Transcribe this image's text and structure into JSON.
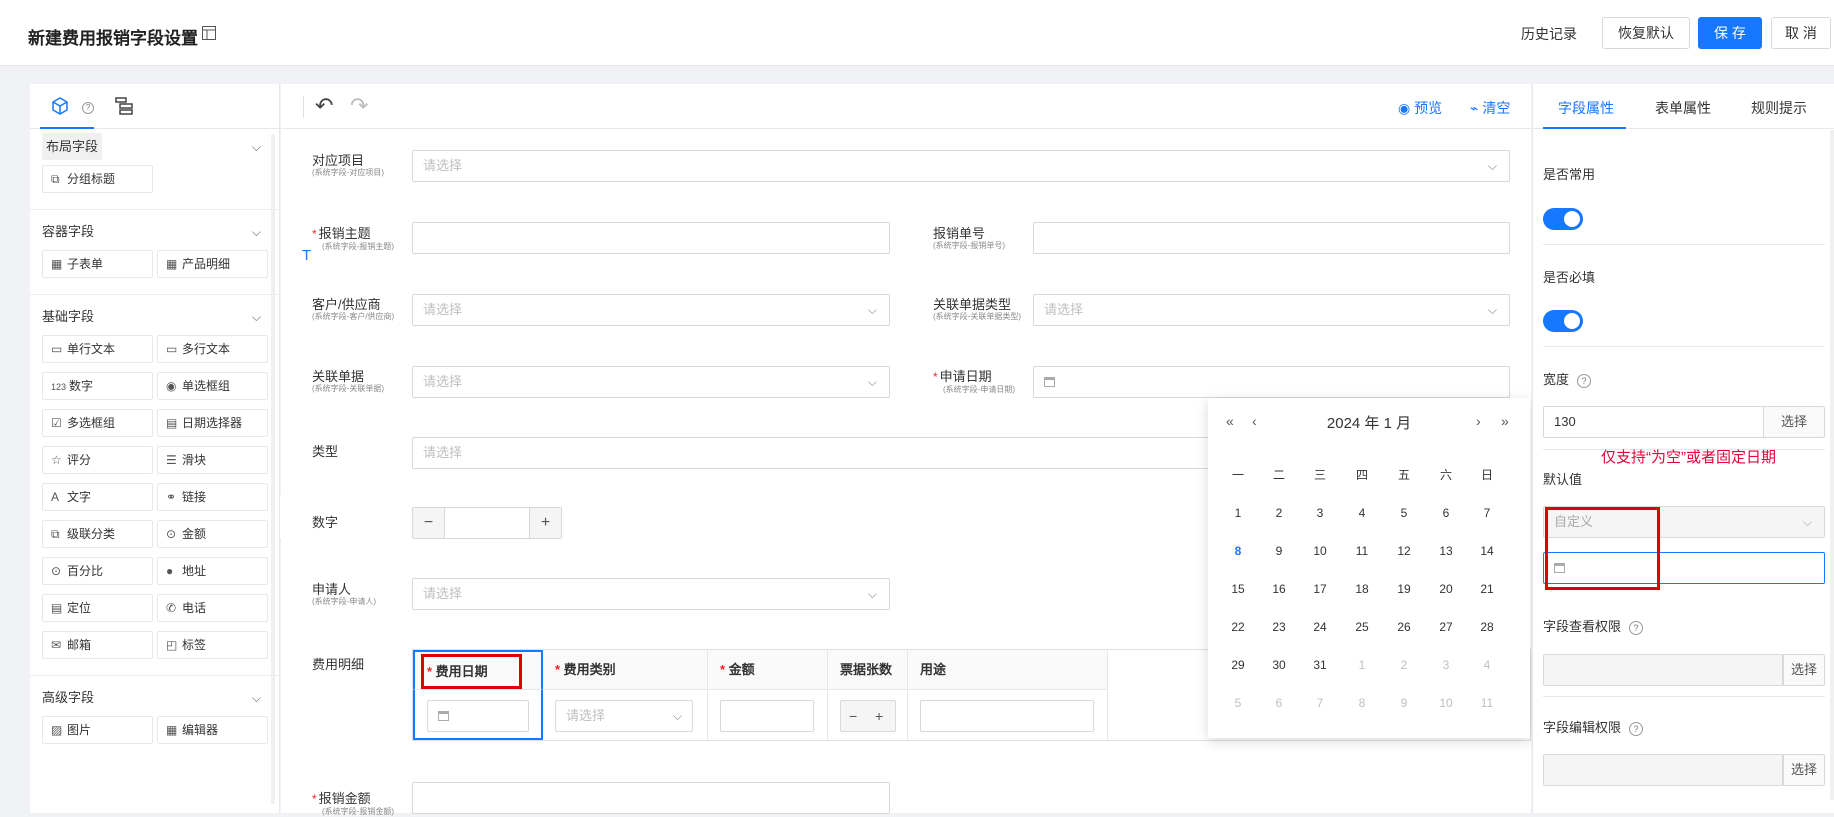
{
  "header": {
    "title": "新建费用报销字段设置",
    "history": "历史记录",
    "restore": "恢复默认",
    "save": "保 存",
    "cancel": "取 消"
  },
  "left": {
    "sections": [
      {
        "title": "布局字段",
        "items": [
          {
            "icon": "group-title-icon",
            "glyph": "⧉",
            "label": "分组标题"
          }
        ]
      },
      {
        "title": "容器字段",
        "items": [
          {
            "icon": "subform-icon",
            "glyph": "▦",
            "label": "子表单"
          },
          {
            "icon": "product-detail-icon",
            "glyph": "▦",
            "label": "产品明细"
          }
        ]
      },
      {
        "title": "基础字段",
        "items": [
          {
            "icon": "single-text-icon",
            "glyph": "▭",
            "label": "单行文本"
          },
          {
            "icon": "multi-text-icon",
            "glyph": "▭",
            "label": "多行文本"
          },
          {
            "icon": "number-icon",
            "glyph": "123",
            "label": "数字"
          },
          {
            "icon": "radio-icon",
            "glyph": "◉",
            "label": "单选框组"
          },
          {
            "icon": "checkbox-icon",
            "glyph": "☑",
            "label": "多选框组"
          },
          {
            "icon": "date-picker-icon",
            "glyph": "▤",
            "label": "日期选择器"
          },
          {
            "icon": "star-icon",
            "glyph": "☆",
            "label": "评分"
          },
          {
            "icon": "slider-icon",
            "glyph": "☰",
            "label": "滑块"
          },
          {
            "icon": "text-icon",
            "glyph": "A",
            "label": "文字"
          },
          {
            "icon": "link-icon",
            "glyph": "⚭",
            "label": "链接"
          },
          {
            "icon": "cascader-icon",
            "glyph": "⧉",
            "label": "级联分类"
          },
          {
            "icon": "amount-icon",
            "glyph": "⊙",
            "label": "金额"
          },
          {
            "icon": "percent-icon",
            "glyph": "⊙",
            "label": "百分比"
          },
          {
            "icon": "location-pin-icon",
            "glyph": "●",
            "label": "地址"
          },
          {
            "icon": "locate-icon",
            "glyph": "▤",
            "label": "定位"
          },
          {
            "icon": "phone-icon",
            "glyph": "✆",
            "label": "电话"
          },
          {
            "icon": "mail-icon",
            "glyph": "✉",
            "label": "邮箱"
          },
          {
            "icon": "tag-icon",
            "glyph": "◰",
            "label": "标签"
          }
        ]
      },
      {
        "title": "高级字段",
        "items": [
          {
            "icon": "image-icon",
            "glyph": "▨",
            "label": "图片"
          },
          {
            "icon": "editor-icon",
            "glyph": "▦",
            "label": "编辑器"
          }
        ]
      }
    ]
  },
  "toolbar": {
    "preview": "预览",
    "clear": "清空"
  },
  "form": {
    "project_label": "对应项目",
    "project_sub": "(系统字段-对应项目)",
    "project_ph": "请选择",
    "subject_label": "报销主题",
    "subject_sub": "(系统字段-报销主题)",
    "no_label": "报销单号",
    "no_sub": "(系统字段-报销单号)",
    "customer_label": "客户/供应商",
    "customer_sub": "(系统字段-客户/供应商)",
    "customer_ph": "请选择",
    "reltype_label": "关联单据类型",
    "reltype_sub": "(系统字段-关联单据类型)",
    "reltype_ph": "请选择",
    "reldoc_label": "关联单据",
    "reldoc_sub": "(系统字段-关联单据)",
    "reldoc_ph": "请选择",
    "applydate_label": "申请日期",
    "applydate_sub": "(系统字段-申请日期)",
    "type_label": "类型",
    "type_ph": "请选择",
    "number_label": "数字",
    "minus": "−",
    "plus": "+",
    "applicant_label": "申请人",
    "applicant_sub": "(系统字段-申请人)",
    "applicant_ph": "请选择",
    "detail_label": "费用明细",
    "amount_label": "报销金额",
    "amount_sub": "(系统字段-报销金额)",
    "t_marker": "T"
  },
  "table": {
    "col_date": "费用日期",
    "col_category": "费用类别",
    "col_amount": "金额",
    "col_count": "票据张数",
    "col_usage": "用途",
    "category_ph": "请选择",
    "minus": "−",
    "plus": "+"
  },
  "calendar": {
    "title": "2024 年  1 月",
    "prev_year": "«",
    "prev_month": "‹",
    "next_month": "›",
    "next_year": "»",
    "weekdays": [
      "一",
      "二",
      "三",
      "四",
      "五",
      "六",
      "日"
    ],
    "weeks": [
      [
        "1",
        "2",
        "3",
        "4",
        "5",
        "6",
        "7"
      ],
      [
        "8",
        "9",
        "10",
        "11",
        "12",
        "13",
        "14"
      ],
      [
        "15",
        "16",
        "17",
        "18",
        "19",
        "20",
        "21"
      ],
      [
        "22",
        "23",
        "24",
        "25",
        "26",
        "27",
        "28"
      ],
      [
        "29",
        "30",
        "31",
        "1",
        "2",
        "3",
        "4"
      ],
      [
        "5",
        "6",
        "7",
        "8",
        "9",
        "10",
        "11"
      ]
    ],
    "today": "8"
  },
  "right": {
    "tabs": [
      "字段属性",
      "表单属性",
      "规则提示"
    ],
    "common_label": "是否常用",
    "required_label": "是否必填",
    "width_label": "宽度",
    "width_value": "130",
    "select": "选择",
    "default_label": "默认值",
    "default_select": "自定义",
    "note": "仅支持“为空”或者固定日期",
    "view_perm_label": "字段查看权限",
    "edit_perm_label": "字段编辑权限",
    "help": "?"
  },
  "colors": {
    "primary": "#1677ff",
    "required": "#f5222d",
    "highlight": "#e00000",
    "note": "#e8003a"
  }
}
